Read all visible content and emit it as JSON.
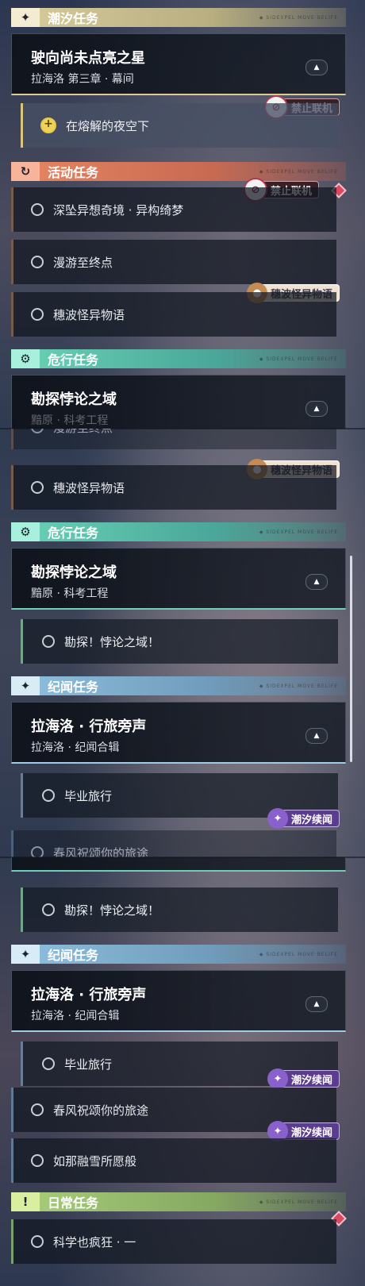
{
  "sections": {
    "tide": "潮汐任务",
    "activity": "活动任务",
    "risk": "危行任务",
    "news": "纪闻任务",
    "daily": "日常任务"
  },
  "section_deco": "◆ SIDEXPEL MOVE·BELIFE",
  "tide_quest": {
    "title": "驶向尚未点亮之星",
    "subtitle": "拉海洛 第三章 · 幕间",
    "step": "在熔解的夜空下"
  },
  "activity_quests": [
    "深坠异想奇境 · 异构绮梦",
    "漫游至终点",
    "穗波怪异物语"
  ],
  "risk_quest": {
    "title": "勘探悖论之域",
    "subtitle": "黯原 · 科考工程",
    "step": "勘探！悖论之域！",
    "partial_subtitle": "黯原 · 科考工程"
  },
  "news_quest": {
    "title": "拉海洛 · 行旅旁声",
    "subtitle": "拉海洛 · 纪闻合辑",
    "step": "毕业旅行"
  },
  "news_extra": [
    "春风祝颂你的旅途",
    "如那融雪所愿般"
  ],
  "daily_quest": "科学也疯狂 · 一",
  "badges": {
    "ban": "禁止联机",
    "capy": "穗波怪异物语",
    "tides": "潮汐续闻"
  },
  "icons": {
    "tide": "sparkle-icon",
    "activity": "refresh-icon",
    "risk": "gear-icon",
    "news": "sparkle-icon",
    "daily": "alert-icon",
    "expand": "chevron-up-icon"
  },
  "colors": {
    "tide": "#d7cc9b",
    "activity": "#e78662",
    "risk": "#6ad3b6",
    "news": "#8fc0df",
    "daily": "#a9cf7a",
    "alert": "#d94a60"
  }
}
